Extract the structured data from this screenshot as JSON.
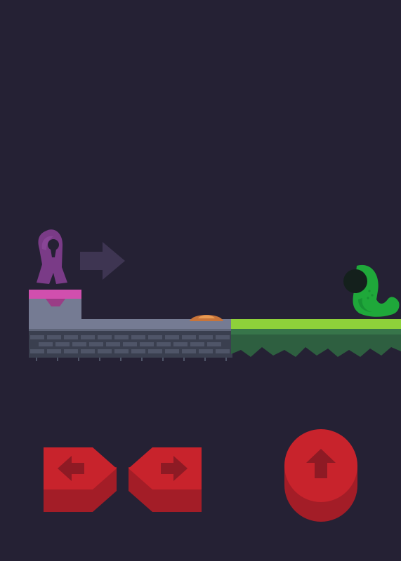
{
  "game": {
    "background_color": "#252134",
    "hero": {
      "name": "purple-hooded-hero",
      "color": "#7a3b87",
      "facing": "right"
    },
    "hint": {
      "icon": "right-arrow-hint-icon",
      "color": "#3e3552"
    },
    "enemy": {
      "name": "green-worm-monster",
      "color": "#1fa83a"
    },
    "pressure_plate": {
      "color": "#e08a3a",
      "state": "unpressed"
    },
    "platforms": [
      {
        "name": "stone-start-block",
        "top_color": "#d14fae",
        "material": "stone"
      },
      {
        "name": "stone-floor",
        "material": "stone-brick"
      },
      {
        "name": "grass-floor",
        "top_color": "#8ed13a",
        "material": "grass"
      }
    ]
  },
  "controls": {
    "button_color": "#c8232c",
    "items": [
      {
        "name": "move-left-button",
        "icon": "left-arrow-icon"
      },
      {
        "name": "move-right-button",
        "icon": "right-arrow-icon"
      },
      {
        "name": "jump-button",
        "icon": "up-arrow-icon"
      }
    ]
  }
}
